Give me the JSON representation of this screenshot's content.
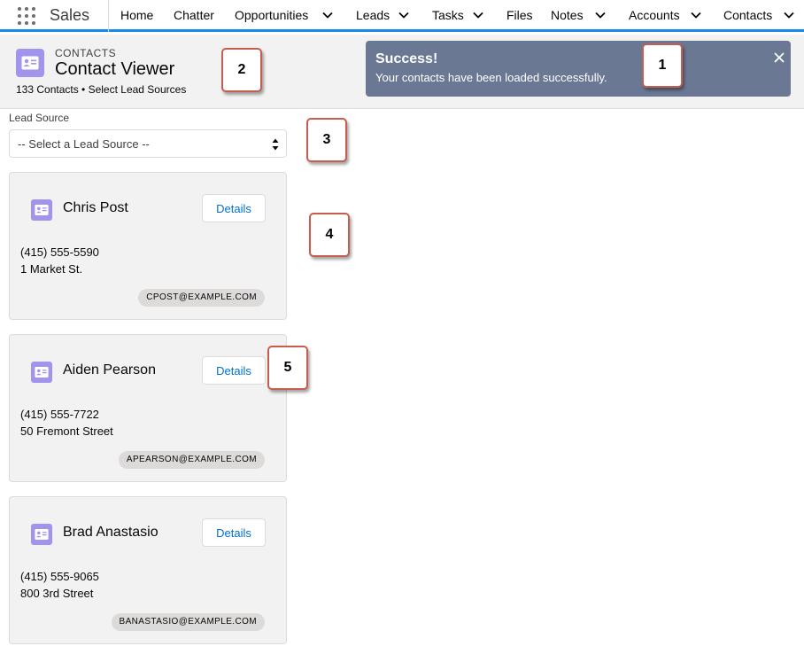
{
  "nav": {
    "app_name": "Sales",
    "items": [
      {
        "label": "Home",
        "has_menu": false
      },
      {
        "label": "Chatter",
        "has_menu": false
      },
      {
        "label": "Opportunities",
        "has_menu": true
      },
      {
        "label": "Leads",
        "has_menu": true
      },
      {
        "label": "Tasks",
        "has_menu": true
      },
      {
        "label": "Files",
        "has_menu": false
      },
      {
        "label": "Notes",
        "has_menu": true
      },
      {
        "label": "Accounts",
        "has_menu": true
      },
      {
        "label": "Contacts",
        "has_menu": true
      }
    ],
    "accent_color": "#1589ee"
  },
  "header": {
    "eyebrow": "CONTACTS",
    "title": "Contact Viewer",
    "subtitle": "133 Contacts • Select Lead Sources",
    "icon": "contact-card-icon",
    "icon_color": "#a094ed"
  },
  "toast": {
    "title": "Success!",
    "message": "Your contacts have been loaded successfully.",
    "close_icon": "close-icon"
  },
  "lead_source": {
    "label": "Lead Source",
    "selected": "-- Select a Lead Source --"
  },
  "contacts": [
    {
      "name": "Chris Post",
      "button": "Details",
      "phone": "(415) 555-5590",
      "address": "1 Market St.",
      "email": "CPOST@EXAMPLE.COM"
    },
    {
      "name": "Aiden Pearson",
      "button": "Details",
      "phone": "(415) 555-7722",
      "address": "50 Fremont Street",
      "email": "APEARSON@EXAMPLE.COM"
    },
    {
      "name": "Brad Anastasio",
      "button": "Details",
      "phone": "(415) 555-9065",
      "address": "800 3rd Street",
      "email": "BANASTASIO@EXAMPLE.COM"
    }
  ],
  "callouts": [
    "1",
    "2",
    "3",
    "4",
    "5"
  ]
}
